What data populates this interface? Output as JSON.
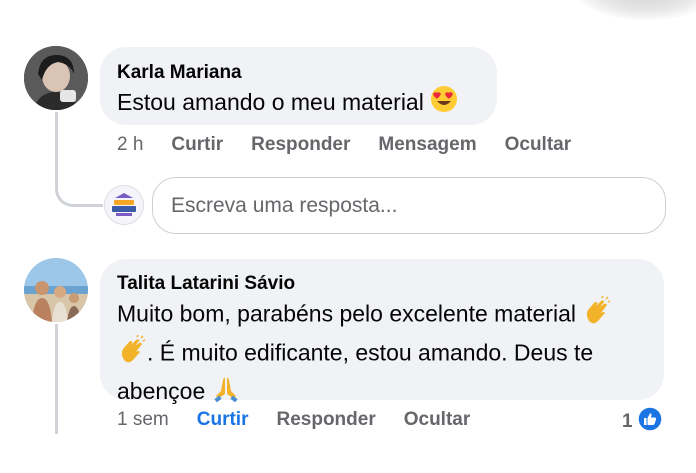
{
  "comments": [
    {
      "author": "Karla Mariana",
      "text": "Estou amando o meu material",
      "time": "2 h",
      "actions": [
        "Curtir",
        "Responder",
        "Mensagem",
        "Ocultar"
      ]
    },
    {
      "author": "Talita Latarini Sávio",
      "text_line1": "Muito bom, parabéns pelo excelente material",
      "text_line2": ". É muito edificante, estou amando. Deus te",
      "text_line3": "abençoe",
      "time": "1 sem",
      "actions": [
        "Curtir",
        "Responder",
        "Ocultar"
      ],
      "reaction_count": "1"
    }
  ],
  "reply": {
    "placeholder": "Escreva uma resposta..."
  },
  "colors": {
    "bubble": "#f0f2f5",
    "action_text": "#65676b",
    "liked": "#1b74e4"
  }
}
